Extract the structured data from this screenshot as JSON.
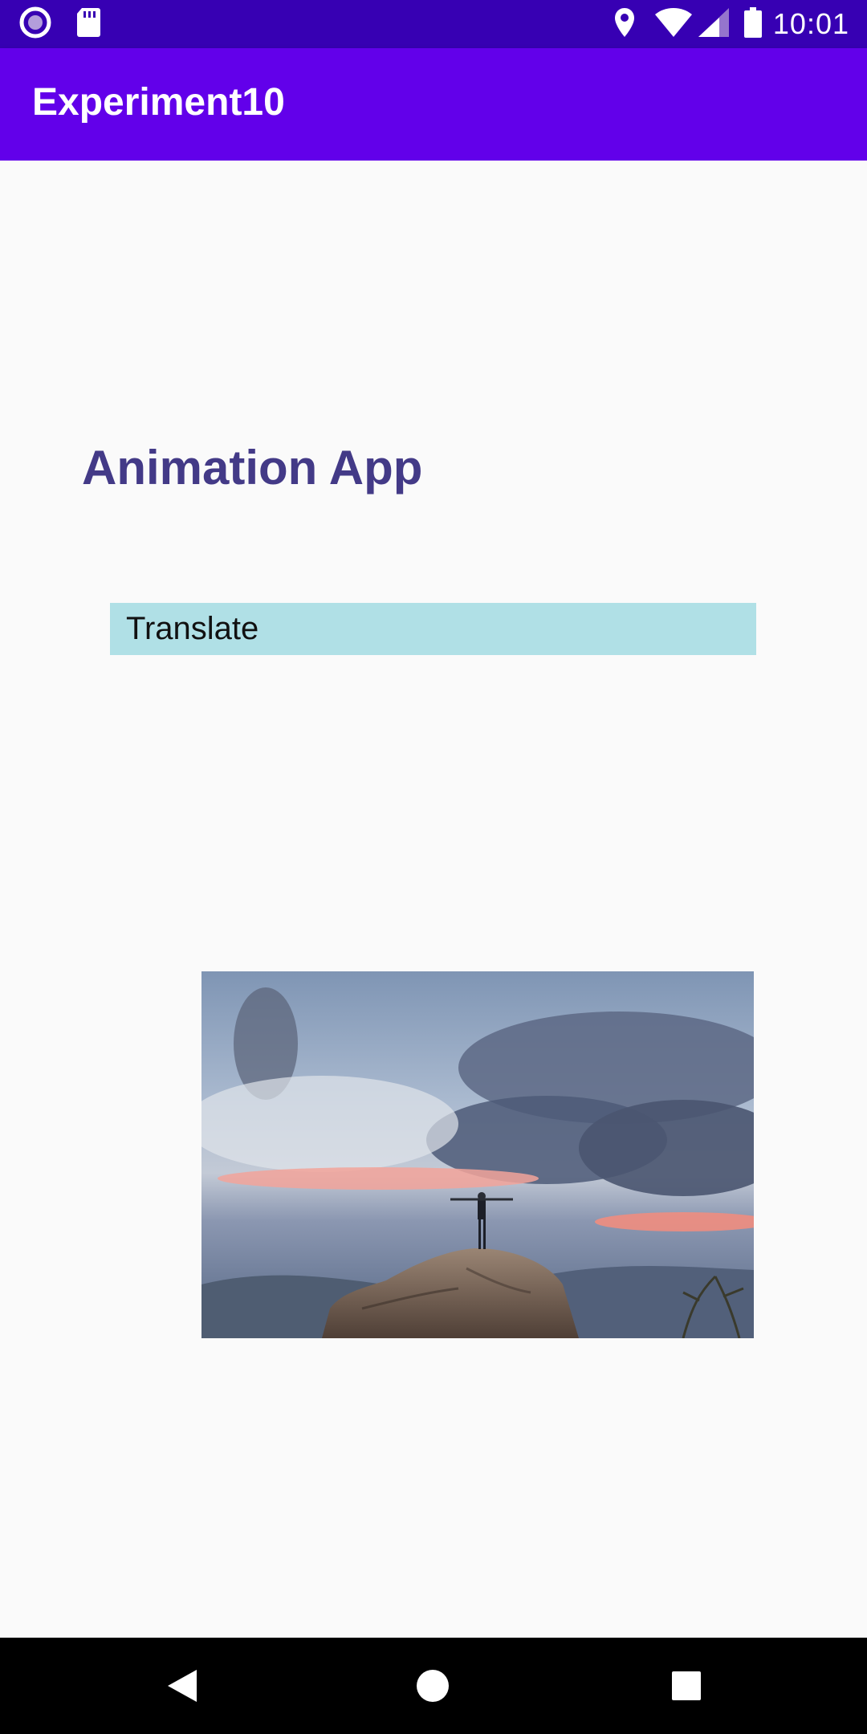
{
  "status_bar": {
    "time": "10:01",
    "icons": [
      "radio-icon",
      "sd-card-icon",
      "location-icon",
      "wifi-icon",
      "signal-icon",
      "battery-icon"
    ]
  },
  "app_bar": {
    "title": "Experiment10",
    "color": "#6200ea"
  },
  "main": {
    "heading": "Animation App",
    "translate_button": "Translate"
  },
  "image": {
    "description_icon": "mountain-photo"
  },
  "nav_bar": {
    "icons": [
      "back-icon",
      "home-icon",
      "recents-icon"
    ]
  }
}
